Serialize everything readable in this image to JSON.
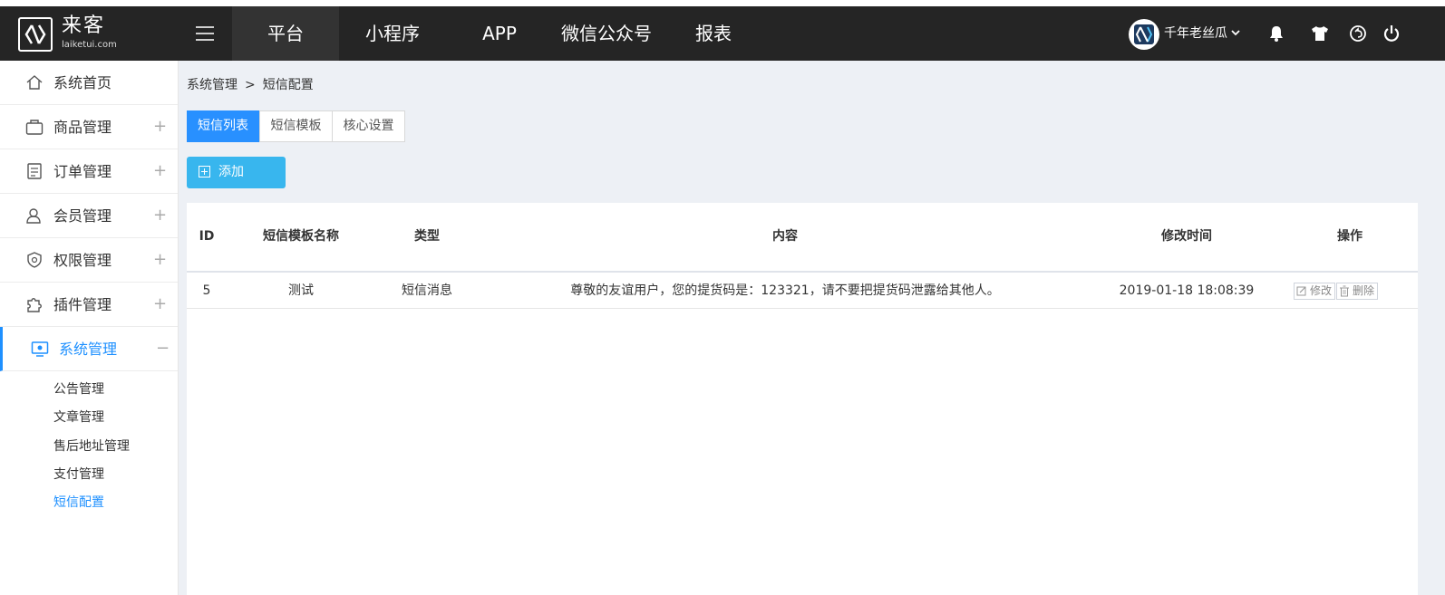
{
  "brand": {
    "name": "来客",
    "domain": "laiketui.com"
  },
  "topnav": {
    "items": [
      {
        "label": "平台",
        "active": true
      },
      {
        "label": "小程序",
        "active": false
      },
      {
        "label": "APP",
        "active": false
      },
      {
        "label": "微信公众号",
        "active": false
      },
      {
        "label": "报表",
        "active": false
      }
    ],
    "username": "千年老丝瓜",
    "icons": [
      "menu-icon",
      "chevron-down-icon",
      "bell-icon",
      "tshirt-icon",
      "undo-icon",
      "power-icon"
    ]
  },
  "sidebar": {
    "items": [
      {
        "label": "系统首页",
        "icon": "home-icon",
        "toggle": ""
      },
      {
        "label": "商品管理",
        "icon": "bag-icon",
        "toggle": "+"
      },
      {
        "label": "订单管理",
        "icon": "clipboard-icon",
        "toggle": "+"
      },
      {
        "label": "会员管理",
        "icon": "user-icon",
        "toggle": "+"
      },
      {
        "label": "权限管理",
        "icon": "shield-icon",
        "toggle": "+"
      },
      {
        "label": "插件管理",
        "icon": "puzzle-icon",
        "toggle": "+"
      },
      {
        "label": "系统管理",
        "icon": "monitor-icon",
        "toggle": "−",
        "active": true
      }
    ],
    "subitems": [
      {
        "label": "公告管理",
        "active": false
      },
      {
        "label": "文章管理",
        "active": false
      },
      {
        "label": "售后地址管理",
        "active": false
      },
      {
        "label": "支付管理",
        "active": false
      },
      {
        "label": "短信配置",
        "active": true
      }
    ]
  },
  "breadcrumb": {
    "parent": "系统管理",
    "separator": ">",
    "current": "短信配置"
  },
  "tabs": [
    {
      "label": "短信列表",
      "active": true
    },
    {
      "label": "短信模板",
      "active": false
    },
    {
      "label": "核心设置",
      "active": false
    }
  ],
  "toolbar": {
    "add_label": "添加"
  },
  "table": {
    "columns": [
      "ID",
      "短信模板名称",
      "类型",
      "内容",
      "修改时间",
      "操作"
    ],
    "rows": [
      {
        "id": "5",
        "name": "测试",
        "type": "短信消息",
        "content": "尊敬的友谊用户，您的提货码是：123321，请不要把提货码泄露给其他人。",
        "modified": "2019-01-18 18:08:39",
        "actions": {
          "edit": "修改",
          "delete": "删除"
        }
      }
    ]
  },
  "colors": {
    "topbar_bg": "#252525",
    "accent_blue": "#2890ff",
    "add_button": "#38b6ee",
    "main_bg": "#edf0f5"
  }
}
